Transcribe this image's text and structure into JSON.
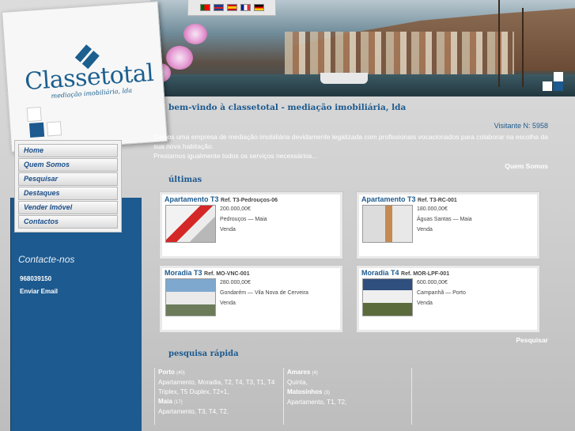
{
  "logo": {
    "name": "Classetotal",
    "tagline": "mediação imobiliária, lda"
  },
  "languages": [
    "pt",
    "en",
    "es",
    "fr",
    "de"
  ],
  "nav": {
    "items": [
      "Home",
      "Quem Somos",
      "Pesquisar",
      "Destaques",
      "Vender Imóvel",
      "Contactos"
    ]
  },
  "contact": {
    "title": "Contacte-nos",
    "phone": "968039150",
    "email_link": "Enviar Email"
  },
  "main": {
    "welcome": "bem-vindo à classetotal - mediação imobiliária, lda",
    "visitor": "Visitante N: 5958",
    "intro_line1": "Somos uma empresa de mediação imobiliária devidamente legalizada com profissionais vocacionados para colaborar na escolha da sua nova habitação.",
    "intro_line2": "Prestamos igualmente todos os serviços necessários...",
    "quem_somos_link": "Quem Somos",
    "ultimas_title": "últimas",
    "pesquisar_link": "Pesquisar",
    "pesquisa_title": "pesquisa rápida"
  },
  "listings": [
    {
      "title": "Apartamento T3",
      "ref": "Ref. T3-Pedrouços-06",
      "price": "200.000,00€",
      "location": "Pedrouços — Maia",
      "status": "Venda"
    },
    {
      "title": "Apartamento T3",
      "ref": "Ref. T3-RC-001",
      "price": "180.000,00€",
      "location": "Águas Santas — Maia",
      "status": "Venda"
    },
    {
      "title": "Moradia T3",
      "ref": "Ref. MO-VNC-001",
      "price": "280.000,00€",
      "location": "Gondarém — Vila Nova de Cerveira",
      "status": "Venda"
    },
    {
      "title": "Moradia T4",
      "ref": "Ref. MOR-LPF-001",
      "price": "600.000,00€",
      "location": "Campanhã — Porto",
      "status": "Venda"
    }
  ],
  "quick_search": {
    "col1": [
      {
        "city": "Porto",
        "count": "(40)",
        "types": "Apartamento, Moradia, T2, T4, T3, T1, T4 Triplex, T5 Duplex, T2+1,"
      },
      {
        "city": "Maia",
        "count": "(17)",
        "types": "Apartamento, T3, T4, T2,"
      }
    ],
    "col2": [
      {
        "city": "Amares",
        "count": "(4)",
        "types": "Quinta,"
      },
      {
        "city": "Matosinhos",
        "count": "(3)",
        "types": "Apartamento, T1, T2,"
      }
    ]
  },
  "colors": {
    "brand_blue": "#1d5a8f",
    "background_gray": "#cfcfcf"
  }
}
